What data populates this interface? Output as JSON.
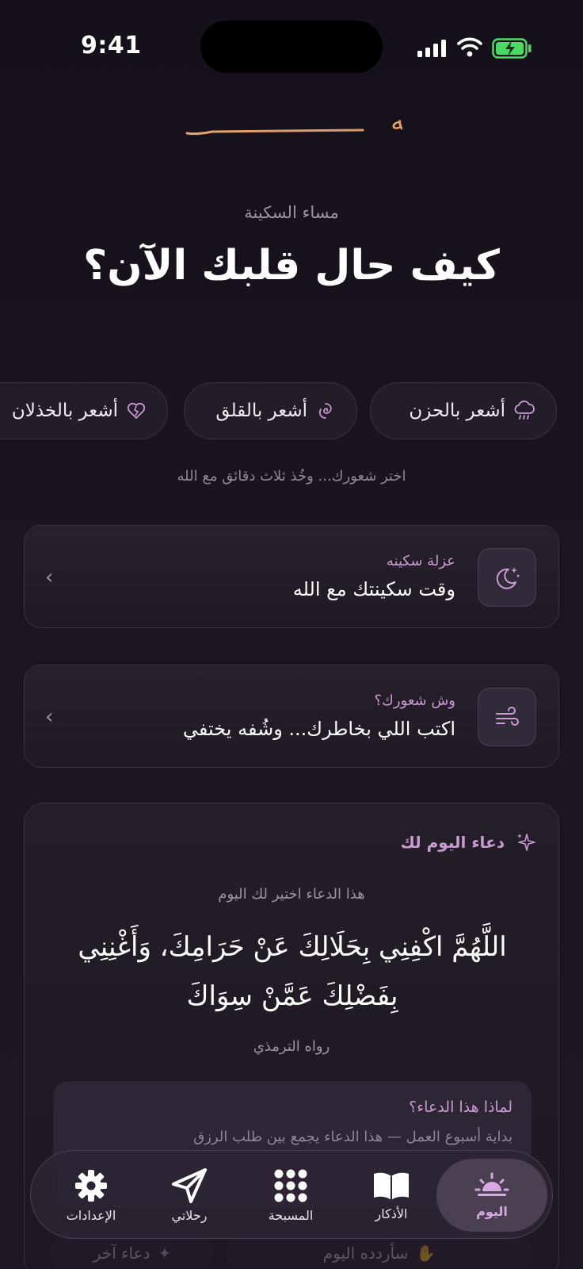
{
  "status": {
    "time": "9:41"
  },
  "app": {
    "logo_text": "سكينه"
  },
  "greeting": "مساء السكينة",
  "headline": "كيف حال قلبك الآن؟",
  "moods": [
    {
      "label": "أشعر بالحزن",
      "icon": "rain-cloud-icon"
    },
    {
      "label": "أشعر بالقلق",
      "icon": "swirl-icon"
    },
    {
      "label": "أشعر بالخذلان",
      "icon": "broken-heart-icon"
    }
  ],
  "hint": "اختر شعورك... وخُذ ثلاث دقائق مع الله",
  "cards": [
    {
      "kicker": "عزلة سكينه",
      "title": "وقت سكينتك مع الله",
      "icon": "moon-stars-icon"
    },
    {
      "kicker": "وش شعورك؟",
      "title": "اكتب اللي بخاطرك... وشُفه يختفي",
      "icon": "wind-icon"
    }
  ],
  "dua": {
    "heading": "دعاء اليوم لك",
    "subtitle": "هذا الدعاء اختير لك اليوم",
    "text": "اللَّهُمَّ اكْفِنِي بِحَلَالِكَ عَنْ حَرَامِكَ، وَأَغْنِنِي بِفَضْلِكَ عَمَّنْ سِوَاكَ",
    "source": "رواه الترمذي",
    "why_title": "لماذا هذا الدعاء؟",
    "why_body": "بداية أسبوع العمل — هذا الدعاء يجمع بين طلب الرزق",
    "action_repeat": "سأردده اليوم",
    "action_other": "دعاء آخر"
  },
  "tabs": [
    {
      "label": "اليوم",
      "icon": "sunrise-icon",
      "active": true
    },
    {
      "label": "الأذكار",
      "icon": "book-icon",
      "active": false
    },
    {
      "label": "المسبحة",
      "icon": "prayer-beads-grid-icon",
      "active": false
    },
    {
      "label": "رحلاتي",
      "icon": "paper-plane-icon",
      "active": false
    },
    {
      "label": "الإعدادات",
      "icon": "gear-icon",
      "active": false
    }
  ],
  "colors": {
    "accent": "#c89cd2",
    "gold": "#e0a86a",
    "background": "#1c1520"
  }
}
